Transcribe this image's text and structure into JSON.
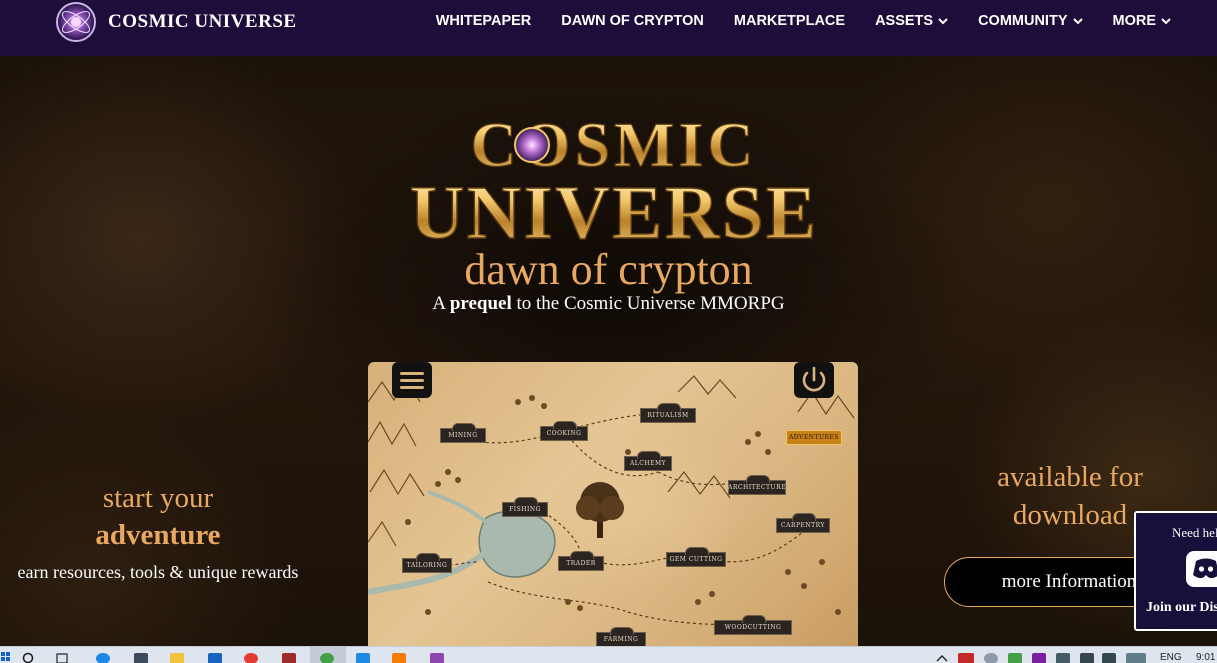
{
  "nav": {
    "brand": "COSMIC UNIVERSE",
    "links": [
      {
        "label": "WHITEPAPER",
        "dropdown": false
      },
      {
        "label": "DAWN OF CRYPTON",
        "dropdown": false
      },
      {
        "label": "MARKETPLACE",
        "dropdown": false
      },
      {
        "label": "ASSETS",
        "dropdown": true
      },
      {
        "label": "COMMUNITY",
        "dropdown": true
      },
      {
        "label": "MORE",
        "dropdown": true
      }
    ]
  },
  "hero": {
    "logo_line1": "COSMIC",
    "logo_line2": "UNIVERSE",
    "tagline": "dawn of crypton",
    "subtitle": {
      "prefix": "A ",
      "bold": "prequel",
      "suffix": " to the Cosmic Universe MMORPG"
    }
  },
  "left": {
    "line1": "start your",
    "line2": "adventure",
    "line3": "earn resources, tools & unique rewards"
  },
  "right": {
    "line1": "available for",
    "line2": "download",
    "button": "more Information"
  },
  "map": {
    "labels": [
      {
        "text": "MINING"
      },
      {
        "text": "COOKING"
      },
      {
        "text": "RITUALISM"
      },
      {
        "text": "ADVENTURES",
        "highlight": true
      },
      {
        "text": "ALCHEMY"
      },
      {
        "text": "ARCHITECTURE"
      },
      {
        "text": "FISHING"
      },
      {
        "text": "CARPENTRY"
      },
      {
        "text": "TAILORING"
      },
      {
        "text": "TRADER"
      },
      {
        "text": "GEM CUTTING"
      },
      {
        "text": "FARMING"
      },
      {
        "text": "WOODCUTTING"
      }
    ]
  },
  "discord": {
    "need": "Need help?",
    "join": "Join our Discord"
  },
  "taskbar": {
    "language": "ENG",
    "time": "9:01"
  },
  "colors": {
    "nav_bg": "#1e0d3a",
    "accent_gold": "#e8a862",
    "discord_bg": "#16103a"
  }
}
